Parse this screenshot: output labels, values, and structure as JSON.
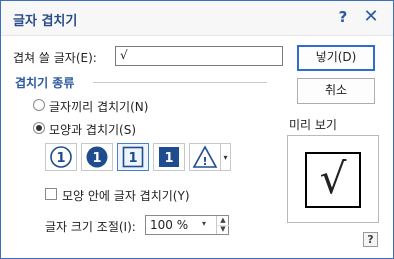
{
  "window": {
    "title": "글자 겹치기",
    "help_symbol": "?",
    "close_symbol": "✕"
  },
  "chars": {
    "label": "겹쳐 쓸 글자(E):",
    "value": "√"
  },
  "buttons": {
    "insert": "넣기(D)",
    "cancel": "취소"
  },
  "overlap_kind": {
    "title": "겹치기 종류",
    "options": [
      {
        "label": "글자끼리 겹치기(N)",
        "checked": false
      },
      {
        "label": "모양과 겹치기(S)",
        "checked": true
      }
    ],
    "shapes": [
      {
        "icon": "circle-outline-icon",
        "glyph": "1",
        "selected": false
      },
      {
        "icon": "circle-filled-icon",
        "glyph": "1",
        "selected": false
      },
      {
        "icon": "square-outline-icon",
        "glyph": "1",
        "selected": true
      },
      {
        "icon": "square-filled-icon",
        "glyph": "1",
        "selected": false
      },
      {
        "icon": "triangle-icon",
        "glyph": "!",
        "selected": false
      }
    ],
    "inside_checkbox_label": "모양 안에 글자 겹치기(Y)",
    "inside_checked": false
  },
  "size_adjust": {
    "label": "글자 크기 조절(I):",
    "value": "100 %"
  },
  "preview": {
    "label": "미리 보기",
    "char": "√"
  },
  "colors": {
    "accent": "#2b5aa0",
    "border_focus": "#2f6bd0"
  }
}
